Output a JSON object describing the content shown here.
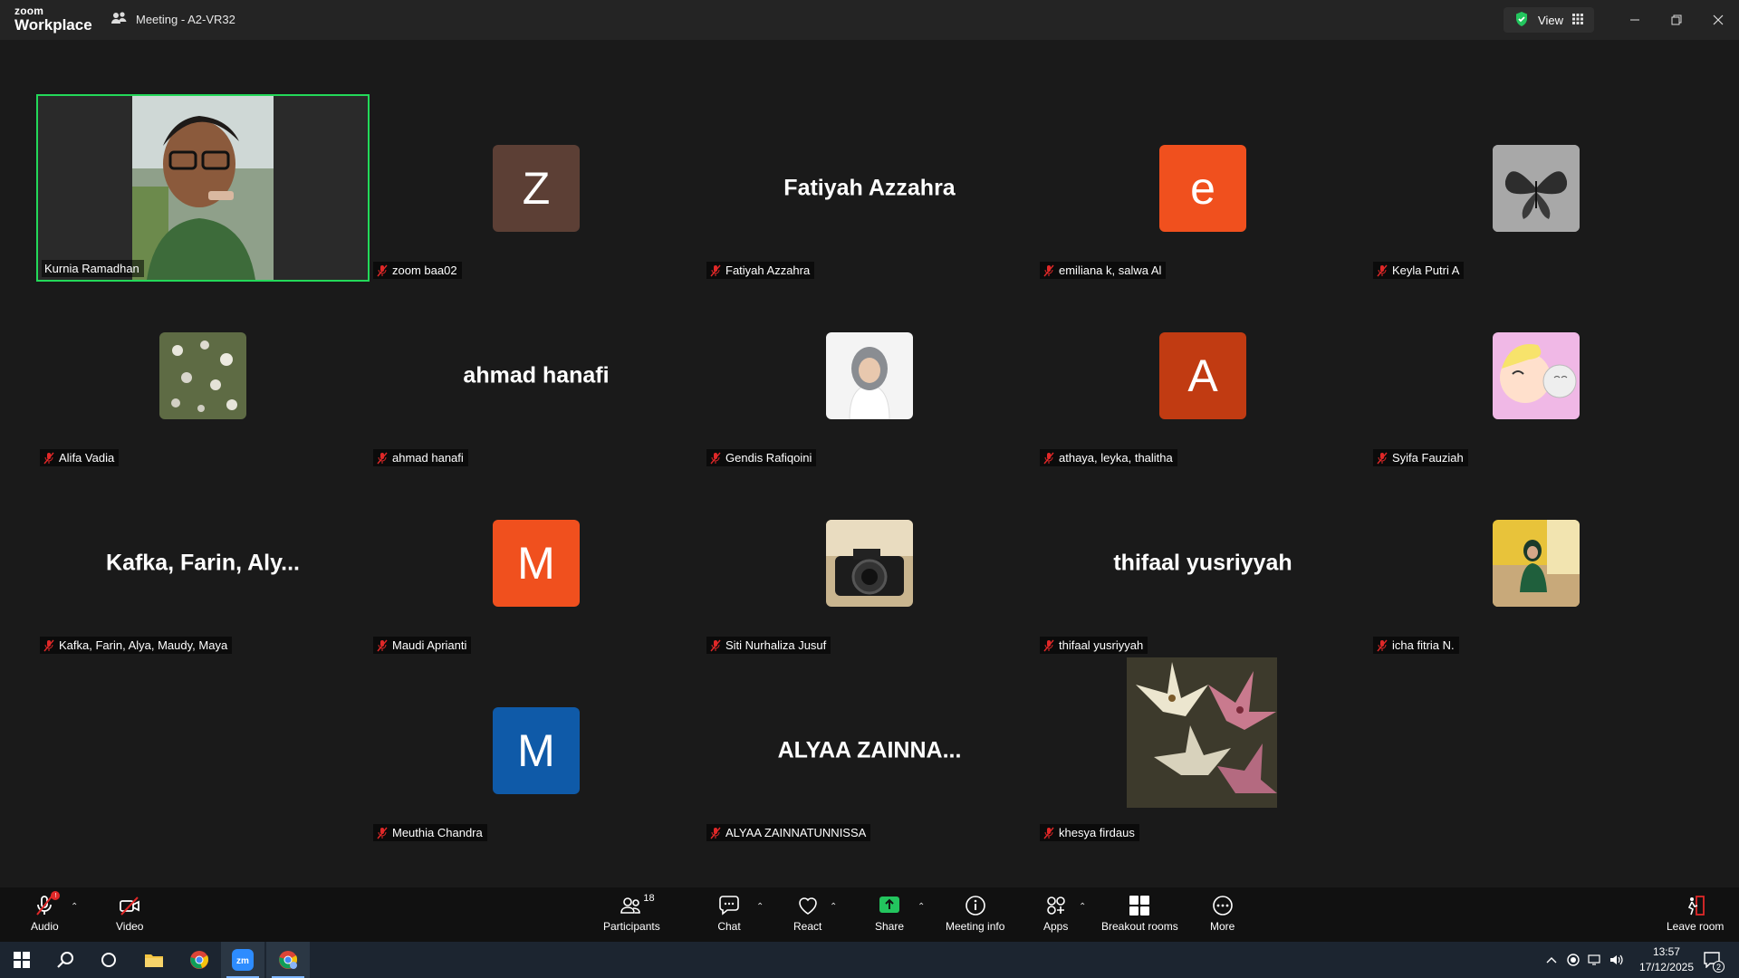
{
  "titlebar": {
    "logo_line1": "zoom",
    "logo_line2": "Workplace",
    "meeting_title": "Meeting - A2-VR32",
    "view_label": "View"
  },
  "tiles": [
    {
      "name": "Kurnia Ramadhan",
      "type": "video",
      "active": true
    },
    {
      "name": "zoom baa02",
      "type": "letter",
      "letter": "Z",
      "color": "#5c3f35"
    },
    {
      "name": "Fatiyah Azzahra",
      "type": "bigname",
      "display": "Fatiyah Azzahra"
    },
    {
      "name": "emiliana k, salwa Al",
      "type": "letter",
      "letter": "e",
      "color": "#f0501e"
    },
    {
      "name": "Keyla Putri A",
      "type": "image",
      "icon": "butterfly-image"
    },
    {
      "name": "Alifa Vadia",
      "type": "image",
      "icon": "flowers-image"
    },
    {
      "name": "ahmad hanafi",
      "type": "bigname",
      "display": "ahmad hanafi"
    },
    {
      "name": "Gendis Rafiqoini",
      "type": "image",
      "icon": "portrait-image"
    },
    {
      "name": "athaya, leyka, thalitha",
      "type": "letter",
      "letter": "A",
      "color": "#c13b12"
    },
    {
      "name": "Syifa Fauziah",
      "type": "image",
      "icon": "cartoon-image"
    },
    {
      "name": "Kafka, Farin, Alya, Maudy, Maya",
      "type": "bigname",
      "display": "Kafka, Farin, Aly..."
    },
    {
      "name": "Maudi Aprianti",
      "type": "letter",
      "letter": "M",
      "color": "#f0501e"
    },
    {
      "name": "Siti Nurhaliza Jusuf",
      "type": "image",
      "icon": "camera-image"
    },
    {
      "name": "thifaal yusriyyah",
      "type": "bigname",
      "display": "thifaal yusriyyah"
    },
    {
      "name": "icha fitria N.",
      "type": "image",
      "icon": "person-photo-image"
    },
    {
      "name": "Meuthia Chandra",
      "type": "letter",
      "letter": "M",
      "color": "#0f5aa8"
    },
    {
      "name": "ALYAA ZAINNATUNNISSA",
      "type": "bigname",
      "display": "ALYAA ZAINNA..."
    },
    {
      "name": "khesya firdaus",
      "type": "image",
      "icon": "lilies-image"
    }
  ],
  "toolbar": {
    "audio": "Audio",
    "video": "Video",
    "participants": "Participants",
    "participants_count": "18",
    "chat": "Chat",
    "react": "React",
    "share": "Share",
    "meeting_info": "Meeting info",
    "apps": "Apps",
    "breakout_rooms": "Breakout rooms",
    "more": "More",
    "leave_room": "Leave room"
  },
  "taskbar": {
    "time": "13:57",
    "date": "17/12/2025",
    "notifications": "2"
  },
  "colors": {
    "active_speaker_border": "#23d959",
    "share_green": "#23c55e",
    "background": "#1a1a1a"
  }
}
